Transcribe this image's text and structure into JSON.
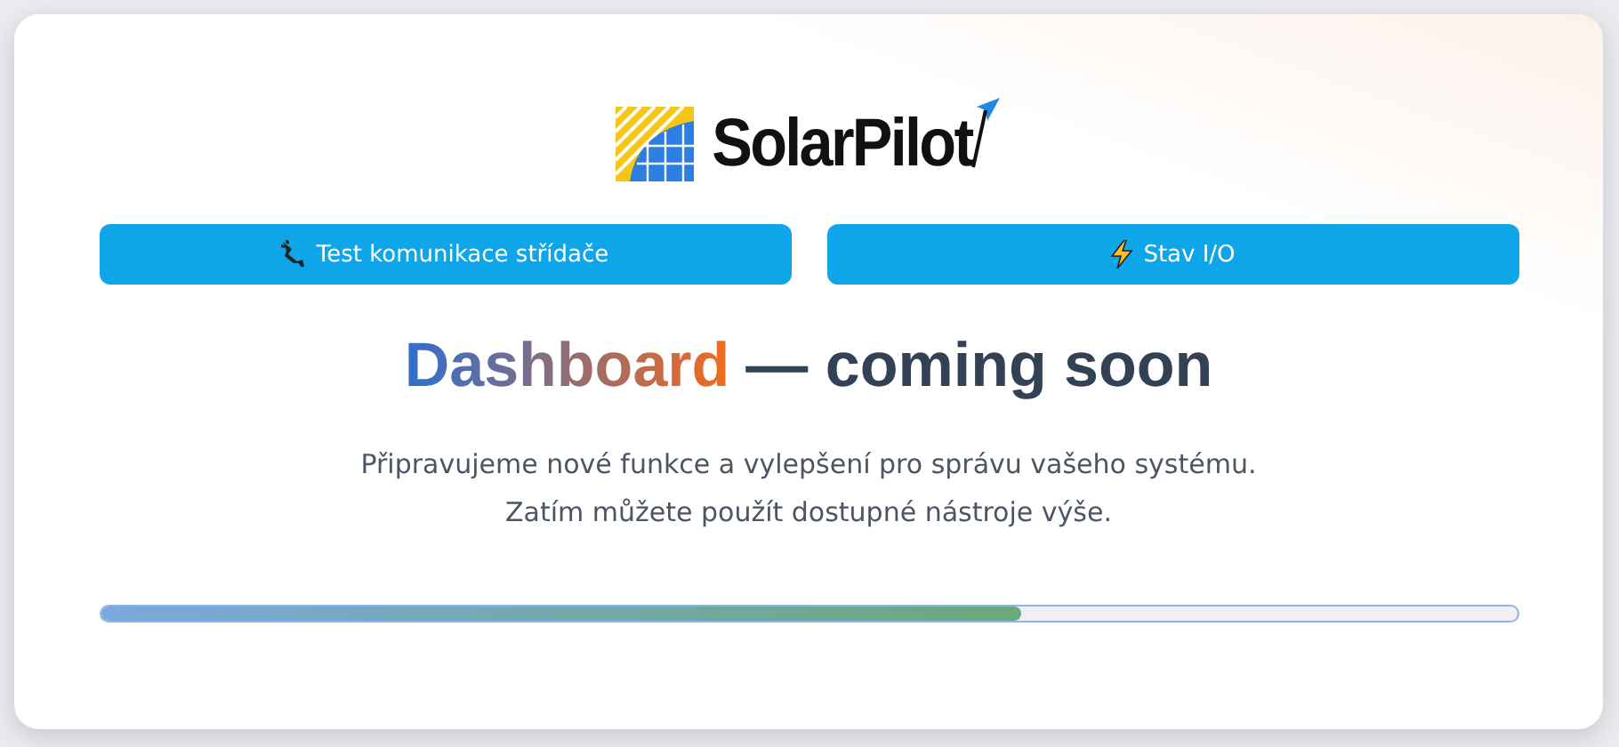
{
  "logo": {
    "text_first": "Solar",
    "text_second": "Pilot"
  },
  "buttons": [
    {
      "label": "Test komunikace střídače"
    },
    {
      "label": "Stav I/O"
    }
  ],
  "heading": {
    "highlight": "Dashboard",
    "rest": "— coming soon"
  },
  "description": [
    "Připravujeme nové funkce a vylepšení pro správu vašeho systému.",
    "Zatím můžete použít dostupné nástroje výše."
  ],
  "progress": {
    "level": 0.65
  }
}
